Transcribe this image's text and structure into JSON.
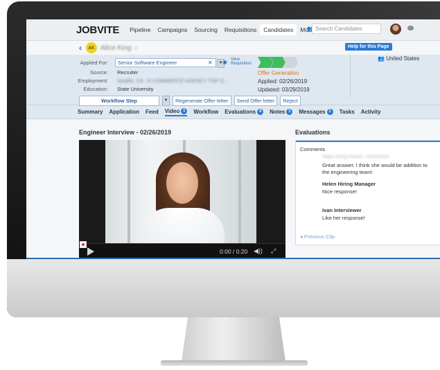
{
  "app": {
    "logo": "JOBVITE",
    "nav": [
      "Pipeline",
      "Campaigns",
      "Sourcing",
      "Requisitions",
      "Candidates",
      "More"
    ],
    "nav_active": "Candidates",
    "search_placeholder": "Search Candidates"
  },
  "candidate": {
    "initials": "AK",
    "name": "Alice King",
    "help_button": "Help for this Page",
    "applied_for_label": "Applied For:",
    "applied_for_value": "Senior Software Engineer",
    "view_requisition": "View Requisition",
    "source_label": "Source:",
    "source_value": "Recruiter",
    "employment_label": "Employment:",
    "employment_value": "Seattle, CA - E-COMMERCE AGENCY TOP G...",
    "education_label": "Education:",
    "education_value": "State University",
    "stage": "Offer Generation",
    "applied": "Applied: 02/26/2019",
    "updated": "Updated: 03/29/2019",
    "country": "United States",
    "progress_stages_completed": 2,
    "progress_stages_total": 3
  },
  "actions": {
    "workflow_step": "Workflow Step",
    "regenerate": "Regenerate Offer letter",
    "send": "Send Offer letter",
    "reject": "Reject"
  },
  "tabs": [
    {
      "label": "Summary",
      "badge": ""
    },
    {
      "label": "Application",
      "badge": ""
    },
    {
      "label": "Feed",
      "badge": ""
    },
    {
      "label": "Video",
      "badge": "1"
    },
    {
      "label": "Workflow",
      "badge": ""
    },
    {
      "label": "Evaluations",
      "badge": "4"
    },
    {
      "label": "Notes",
      "badge": "1"
    },
    {
      "label": "Messages",
      "badge": "1"
    },
    {
      "label": "Tasks",
      "badge": ""
    },
    {
      "label": "Activity",
      "badge": ""
    }
  ],
  "video": {
    "title": "Engineer Interview - 02/26/2019",
    "time": "0:00 / 0:20"
  },
  "evaluations": {
    "title": "Evaluations",
    "comments_label": "Comments",
    "posted_meta": "Helen Hiring  Posted - 02/26/2019",
    "first_comment": "Great answer. I think she would be addition to the engineering team!",
    "entries": [
      {
        "name": "Helen Hiring Manager",
        "text": "Nice response!"
      },
      {
        "name": "Ivan Interviewer",
        "text": "Like her response!"
      }
    ],
    "previous_clip": "Previous Clip"
  },
  "colors": {
    "accent": "#2b7bd4",
    "stage": "#e0701a",
    "progress_done": "#3dbd5d",
    "progress_pending": "#d0d4d8"
  }
}
